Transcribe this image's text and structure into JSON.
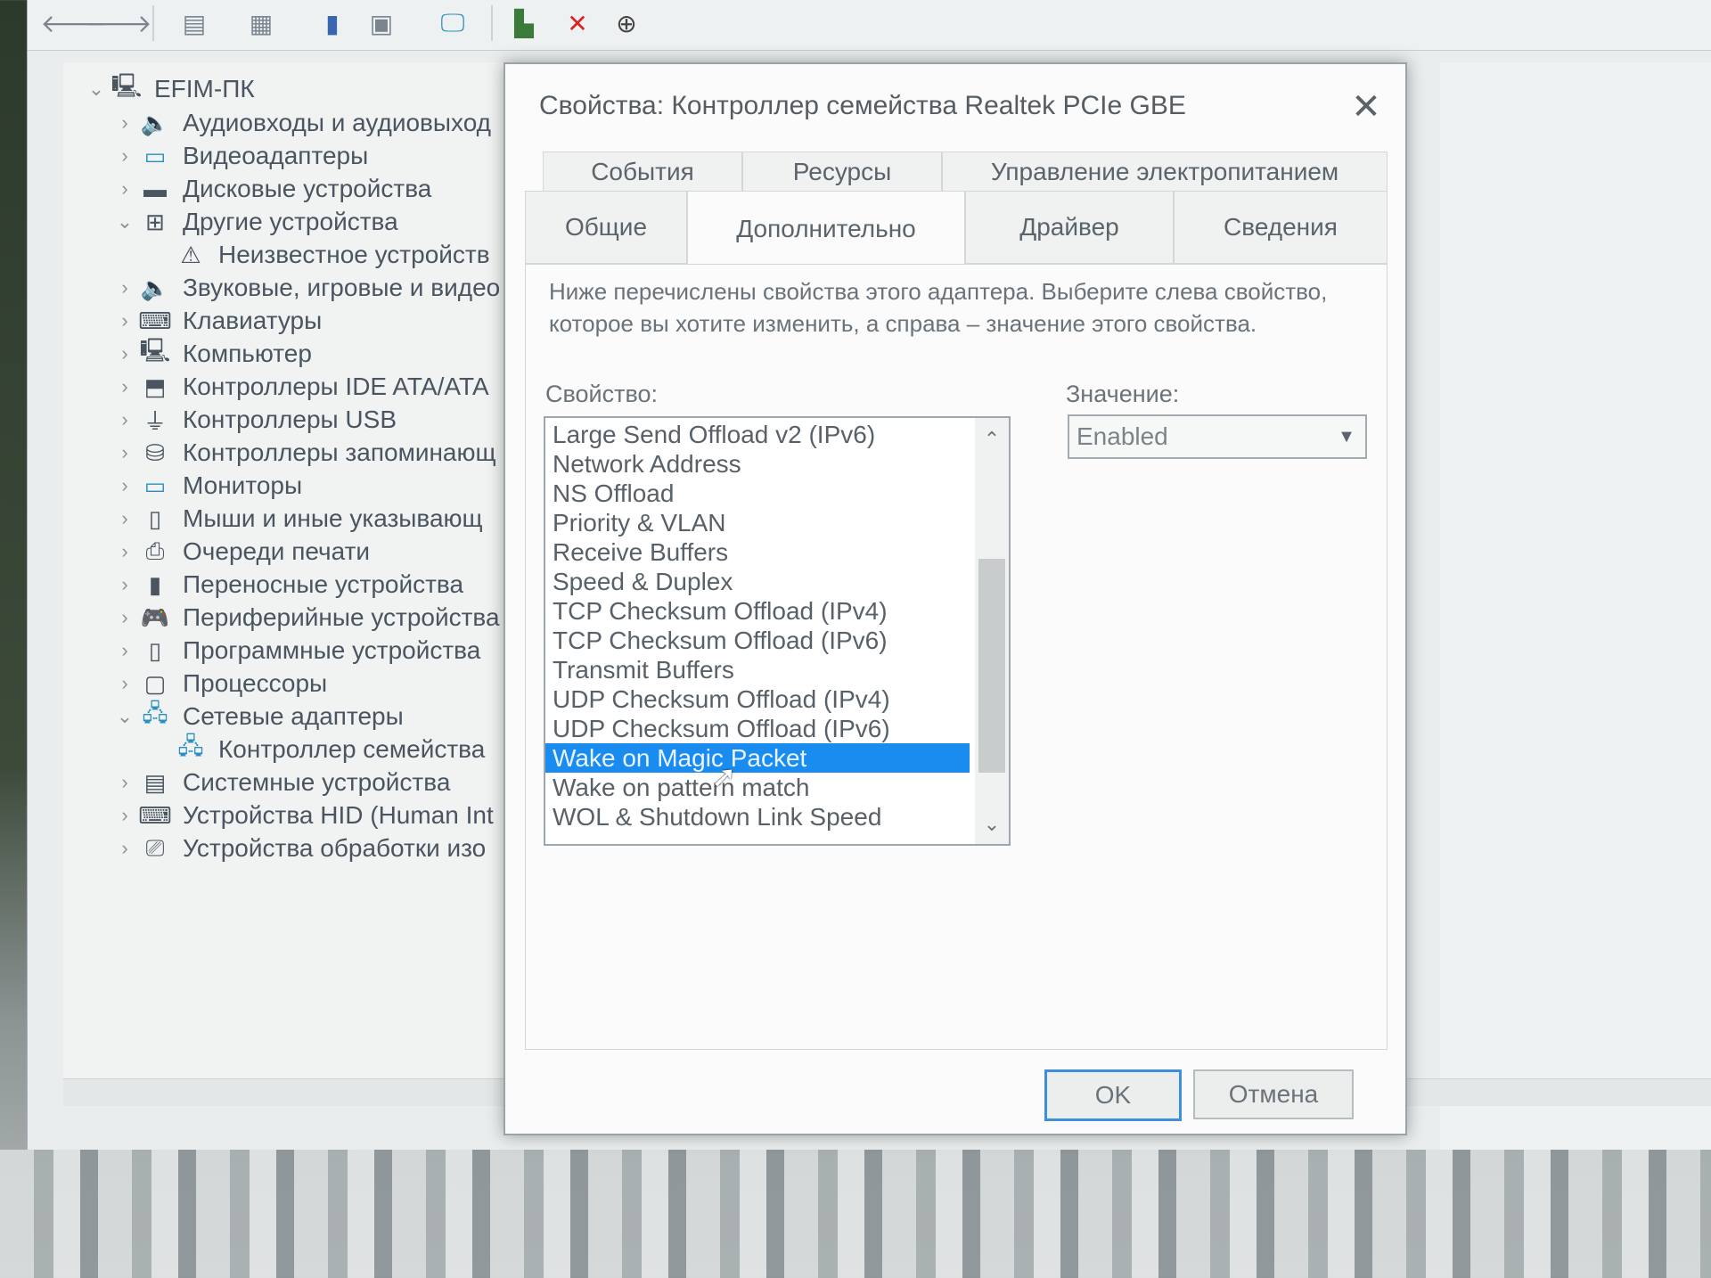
{
  "toolbar": {
    "icons": [
      "back-arrow-icon",
      "forward-arrow-icon",
      "properties-icon",
      "show-hide-icon",
      "help-icon",
      "view-icon",
      "monitor-icon",
      "update-driver-icon",
      "uninstall-icon",
      "disable-icon"
    ]
  },
  "tree": {
    "root": "EFIM-ПК",
    "items": [
      {
        "label": "Аудиовходы и аудиовыход",
        "icon": "speaker-icon",
        "expanded": false,
        "level": 1
      },
      {
        "label": "Видеоадаптеры",
        "icon": "display-adapter-icon",
        "expanded": false,
        "level": 1
      },
      {
        "label": "Дисковые устройства",
        "icon": "disk-drive-icon",
        "expanded": false,
        "level": 1
      },
      {
        "label": "Другие устройства",
        "icon": "other-devices-icon",
        "expanded": true,
        "level": 1
      },
      {
        "label": "Неизвестное устройств",
        "icon": "warning-device-icon",
        "expanded": null,
        "level": 2
      },
      {
        "label": "Звуковые, игровые и видео",
        "icon": "sound-icon",
        "expanded": false,
        "level": 1
      },
      {
        "label": "Клавиатуры",
        "icon": "keyboard-icon",
        "expanded": false,
        "level": 1
      },
      {
        "label": "Компьютер",
        "icon": "computer-icon",
        "expanded": false,
        "level": 1
      },
      {
        "label": "Контроллеры IDE ATA/ATA",
        "icon": "ide-controller-icon",
        "expanded": false,
        "level": 1
      },
      {
        "label": "Контроллеры USB",
        "icon": "usb-icon",
        "expanded": false,
        "level": 1
      },
      {
        "label": "Контроллеры запоминающ",
        "icon": "storage-controller-icon",
        "expanded": false,
        "level": 1
      },
      {
        "label": "Мониторы",
        "icon": "monitor-icon",
        "expanded": false,
        "level": 1
      },
      {
        "label": "Мыши и иные указывающ",
        "icon": "mouse-icon",
        "expanded": false,
        "level": 1
      },
      {
        "label": "Очереди печати",
        "icon": "printer-icon",
        "expanded": false,
        "level": 1
      },
      {
        "label": "Переносные устройства",
        "icon": "portable-device-icon",
        "expanded": false,
        "level": 1
      },
      {
        "label": "Периферийные устройства",
        "icon": "gamepad-icon",
        "expanded": false,
        "level": 1
      },
      {
        "label": "Программные устройства",
        "icon": "software-device-icon",
        "expanded": false,
        "level": 1
      },
      {
        "label": "Процессоры",
        "icon": "processor-icon",
        "expanded": false,
        "level": 1
      },
      {
        "label": "Сетевые адаптеры",
        "icon": "network-adapter-icon",
        "expanded": true,
        "level": 1
      },
      {
        "label": "Контроллер семейства",
        "icon": "network-card-icon",
        "expanded": null,
        "level": 2
      },
      {
        "label": "Системные устройства",
        "icon": "system-device-icon",
        "expanded": false,
        "level": 1
      },
      {
        "label": "Устройства HID (Human Int",
        "icon": "hid-icon",
        "expanded": false,
        "level": 1
      },
      {
        "label": "Устройства обработки изо",
        "icon": "imaging-device-icon",
        "expanded": false,
        "level": 1
      }
    ]
  },
  "dialog": {
    "title": "Свойства: Контроллер семейства Realtek PCIe GBE",
    "tabs_row1": [
      "События",
      "Ресурсы",
      "Управление электропитанием"
    ],
    "tabs_row2": [
      "Общие",
      "Дополнительно",
      "Драйвер",
      "Сведения"
    ],
    "active_tab": "Дополнительно",
    "description": "Ниже перечислены свойства этого адаптера. Выберите слева свойство, которое вы хотите изменить, а справа – значение этого свойства.",
    "property_label": "Свойство:",
    "value_label": "Значение:",
    "properties": [
      "Large Send Offload v2 (IPv6)",
      "Network Address",
      "NS Offload",
      "Priority & VLAN",
      "Receive Buffers",
      "Speed & Duplex",
      "TCP Checksum Offload (IPv4)",
      "TCP Checksum Offload (IPv6)",
      "Transmit Buffers",
      "UDP Checksum Offload (IPv4)",
      "UDP Checksum Offload (IPv6)",
      "Wake on Magic Packet",
      "Wake on pattern match",
      "WOL & Shutdown Link Speed"
    ],
    "selected_property": "Wake on Magic Packet",
    "value": "Enabled",
    "ok_label": "OK",
    "cancel_label": "Отмена"
  }
}
